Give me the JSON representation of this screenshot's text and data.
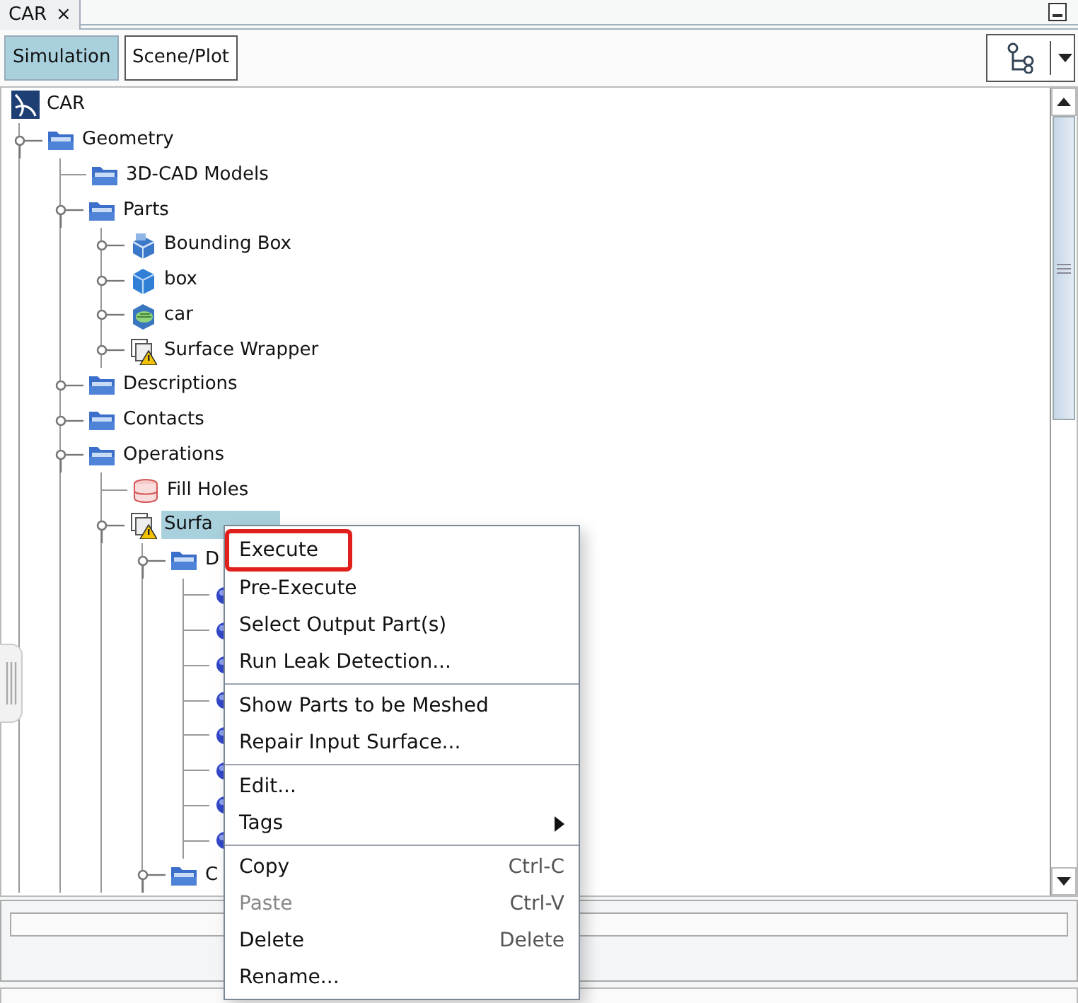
{
  "document_tab": {
    "title": "CAR",
    "close": "×"
  },
  "view_tabs": [
    {
      "label": "Simulation",
      "selected": true
    },
    {
      "label": "Scene/Plot",
      "selected": false
    }
  ],
  "tree": {
    "root": {
      "label": "CAR",
      "kind": "logo",
      "selected": false,
      "children": [
        {
          "label": "Geometry",
          "kind": "folder",
          "expanded": true,
          "selected": false,
          "children": [
            {
              "label": "3D-CAD Models",
              "kind": "folder",
              "selected": false
            },
            {
              "label": "Parts",
              "kind": "folder",
              "expanded": true,
              "selected": false,
              "children": [
                {
                  "label": "Bounding Box",
                  "kind": "block",
                  "expanded": false,
                  "selected": false
                },
                {
                  "label": "box",
                  "kind": "cube",
                  "expanded": false,
                  "selected": false
                },
                {
                  "label": "car",
                  "kind": "mesh-part",
                  "expanded": false,
                  "selected": false
                },
                {
                  "label": "Surface Wrapper",
                  "kind": "wrapper",
                  "expanded": false,
                  "selected": false
                }
              ]
            },
            {
              "label": "Descriptions",
              "kind": "folder",
              "expanded": false,
              "selected": false
            },
            {
              "label": "Contacts",
              "kind": "folder",
              "expanded": false,
              "selected": false
            },
            {
              "label": "Operations",
              "kind": "folder",
              "expanded": true,
              "selected": false,
              "children": [
                {
                  "label": "Fill Holes",
                  "kind": "cylinder",
                  "selected": false
                },
                {
                  "label": "Surfa",
                  "kind": "wrapper",
                  "expanded": true,
                  "selected": true,
                  "children": [
                    {
                      "label": "D",
                      "kind": "folder",
                      "expanded": true,
                      "selected": false,
                      "children": [
                        {
                          "kind": "sphere",
                          "selected": false
                        },
                        {
                          "kind": "sphere",
                          "selected": false
                        },
                        {
                          "kind": "sphere",
                          "selected": false
                        },
                        {
                          "kind": "sphere",
                          "selected": false
                        },
                        {
                          "kind": "sphere",
                          "selected": false
                        },
                        {
                          "kind": "sphere",
                          "selected": false
                        },
                        {
                          "kind": "sphere",
                          "selected": false
                        },
                        {
                          "kind": "sphere",
                          "selected": false
                        }
                      ]
                    },
                    {
                      "label": "C",
                      "kind": "folder",
                      "expanded": true,
                      "selected": false
                    }
                  ]
                }
              ]
            }
          ]
        }
      ]
    }
  },
  "context_menu": {
    "groups": [
      [
        {
          "label": "Execute",
          "outlined": true,
          "disabled": false
        },
        {
          "label": "Pre-Execute",
          "outlined": false,
          "disabled": false
        },
        {
          "label": "Select Output Part(s)",
          "outlined": false,
          "disabled": false
        },
        {
          "label": "Run Leak Detection...",
          "outlined": false,
          "disabled": false
        }
      ],
      [
        {
          "label": "Show Parts to be Meshed",
          "outlined": false,
          "disabled": false
        },
        {
          "label": "Repair Input Surface...",
          "outlined": false,
          "disabled": false
        }
      ],
      [
        {
          "label": "Edit...",
          "outlined": false,
          "disabled": false
        },
        {
          "label": "Tags",
          "submenu": true,
          "outlined": false,
          "disabled": false
        }
      ],
      [
        {
          "label": "Copy",
          "shortcut": "Ctrl-C",
          "outlined": false,
          "disabled": false
        },
        {
          "label": "Paste",
          "shortcut": "Ctrl-V",
          "outlined": false,
          "disabled": true
        },
        {
          "label": "Delete",
          "shortcut": "Delete",
          "outlined": false,
          "disabled": false
        },
        {
          "label": "Rename...",
          "outlined": false,
          "disabled": false
        }
      ]
    ]
  }
}
